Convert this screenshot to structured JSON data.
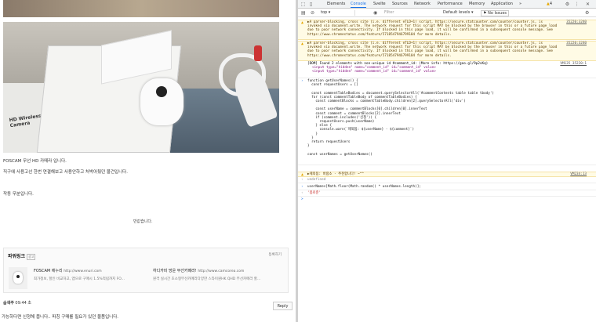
{
  "page": {
    "caption": "FOSCAM 무선 HD 카메라 입니다.",
    "line2": "직구에 사용고선 한번 연결해보고 사용안하고 처박아뒀던 물건입니다.",
    "line3": "작동 무분입니다.",
    "reply_count": "반값습니다.",
    "photo_box_label": "HD Wireless IP Camera"
  },
  "related": {
    "title": "파워링크",
    "ad_badge": "광고",
    "more": "등록하기",
    "ads": [
      {
        "name": "FOSCAM 에누리",
        "url": "http://www.enuri.com",
        "desc": "최가정보, 할인 비교하고, 앱으로 구매시 1.5%적립까지 FO..."
      },
      {
        "name": "하디카미 망운 무선카메라!",
        "url": "http://www.camcorea.com",
        "desc": "원격 실시간 초소형무선카메라다양한 스타이원HK QHD 무선카메라 할..."
      }
    ]
  },
  "comment": {
    "author": "솜색주",
    "time": "09:44 초",
    "reply_label": "Reply",
    "text": "가능하다면 신청해 봅니다.. 파칭 구매를 필요가 있던 물품입니다."
  },
  "devtools": {
    "tabs": [
      "Elements",
      "Console",
      "Svelte",
      "Sources",
      "Network",
      "Performance",
      "Memory",
      "Application"
    ],
    "active_tab": "Console",
    "overflow": "»",
    "warning_count": "4",
    "context": "top",
    "filter_placeholder": "Filter",
    "levels": "Default levels ▾",
    "issues": "No Issues",
    "messages": {
      "warn1": "▶A parser-blocking, cross site (i.e. different eTLD+1) script, https://secure.statcounter.com/counter/counter.js, is invoked via document.write. The network request for this script MAY be blocked by the browser in this or a future page load due to poor network connectivity. If blocked in this page load, it will be confirmed in a subsequent console message. See https://www.chromestatus.com/feature/5718547946799104 for more details.",
      "warn1_loc": "35220:3240",
      "warn2": "▶A parser-blocking, cross site (i.e. different eTLD+1) script, https://secure.statcounter.com/counter/counter.js, is invoked via document.write. The network request for this script MAY be blocked by the browser in this or a future page load due to poor network connectivity. If blocked in this page load, it will be confirmed in a subsequent console message. See https://www.chromestatus.com/feature/5718547946799104 for more details.",
      "warn2_loc": "35220:3240",
      "dom": "[DOM] Found 2 elements with non-unique id #comment_id: (More info: https://goo.gl/9p2vKq)",
      "dom_loc": "VM135 35220:1",
      "dom_el1": "<input type=\"hidden\" name=\"comment_id\" id=\"comment_id\" value>",
      "dom_el2": "<input type=\"hidden\" name=\"comment_id\" id=\"comment_id\" value>",
      "code": [
        "function getUserNames() {",
        "  const requestUsers = []",
        "",
        "  const commentTableBodies = document.querySelectorAll('#commentContents table table tbody')",
        "  for (const commentTableBody of commentTableBodies) {",
        "    const commentBlocks = commentTableBody.children[2].querySelectorAll('div')",
        "",
        "    const userName = commentBlocks[0].children[0].innerText",
        "    const comment = commentBlocks[2].innerText",
        "    if (comment.includes('신청')) {",
        "      requestUsers.push(userName)",
        "    } else {",
        "      console.warn(`제외됨: ${userName} - ${comment}`)",
        "    }",
        "  }",
        "  return requestUsers",
        "}",
        "",
        "const userNames = getUserNames()"
      ],
      "warn3": "▶제외됨: 바람소 - 추천합니다! ~^^",
      "warn3_loc": "VM234:13",
      "undefined": "undefined",
      "expr": "userNames[Math.floor(Math.random() * userNames.length)];",
      "result": "'몽로준'",
      "prompt": ">"
    }
  }
}
